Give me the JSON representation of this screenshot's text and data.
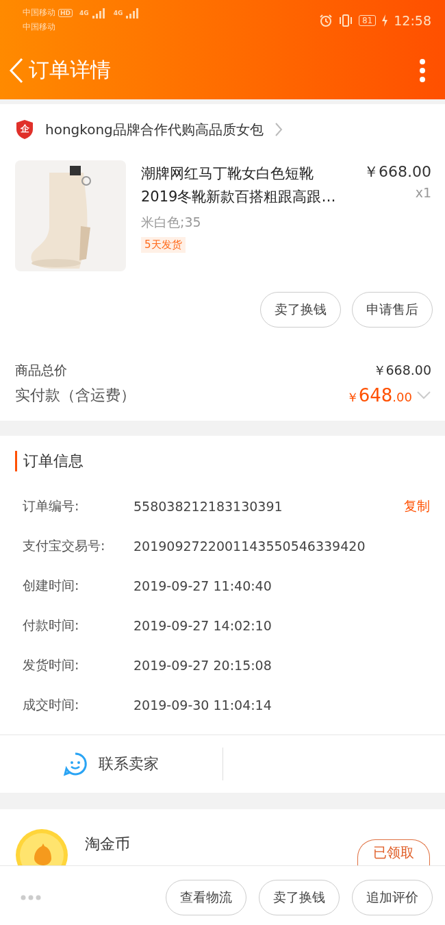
{
  "status_bar": {
    "carrier_1": "中国移动",
    "hd_badge": "HD",
    "carrier_2": "中国移动",
    "network_1": "4G",
    "network_2": "4G",
    "battery": "81",
    "time": "12:58"
  },
  "header": {
    "title": "订单详情"
  },
  "shop": {
    "name": "hongkong品牌合作代购高品质女包",
    "badge": "企"
  },
  "product": {
    "title_lines": [
      "潮牌网红马丁靴女白色短靴",
      "2019冬靴新款百搭粗跟高跟…"
    ],
    "variant": "米白色;35",
    "tag": "5天发货",
    "price": "￥668.00",
    "quantity": "x1"
  },
  "product_actions": [
    "卖了换钱",
    "申请售后"
  ],
  "summary": {
    "total_label": "商品总价",
    "total_value": "￥668.00",
    "paid_label": "实付款（含运费）",
    "paid_currency": "￥",
    "paid_integer": "648",
    "paid_decimals": ".00"
  },
  "order_info": {
    "title": "订单信息",
    "rows": [
      {
        "label": "订单编号:",
        "value": "558038212183130391",
        "action": "复制"
      },
      {
        "label": "支付宝交易号:",
        "value": "2019092722001143550546339420"
      },
      {
        "label": "创建时间:",
        "value": "2019-09-27 11:40:40"
      },
      {
        "label": "付款时间:",
        "value": "2019-09-27 14:02:10"
      },
      {
        "label": "发货时间:",
        "value": "2019-09-27 20:15:08"
      },
      {
        "label": "成交时间:",
        "value": "2019-09-30 11:04:14"
      }
    ]
  },
  "contact": {
    "label": "联系卖家"
  },
  "coin": {
    "title": "淘金币",
    "button": "已领取"
  },
  "bottom_bar": {
    "actions": [
      "查看物流",
      "卖了换钱",
      "追加评价"
    ]
  }
}
